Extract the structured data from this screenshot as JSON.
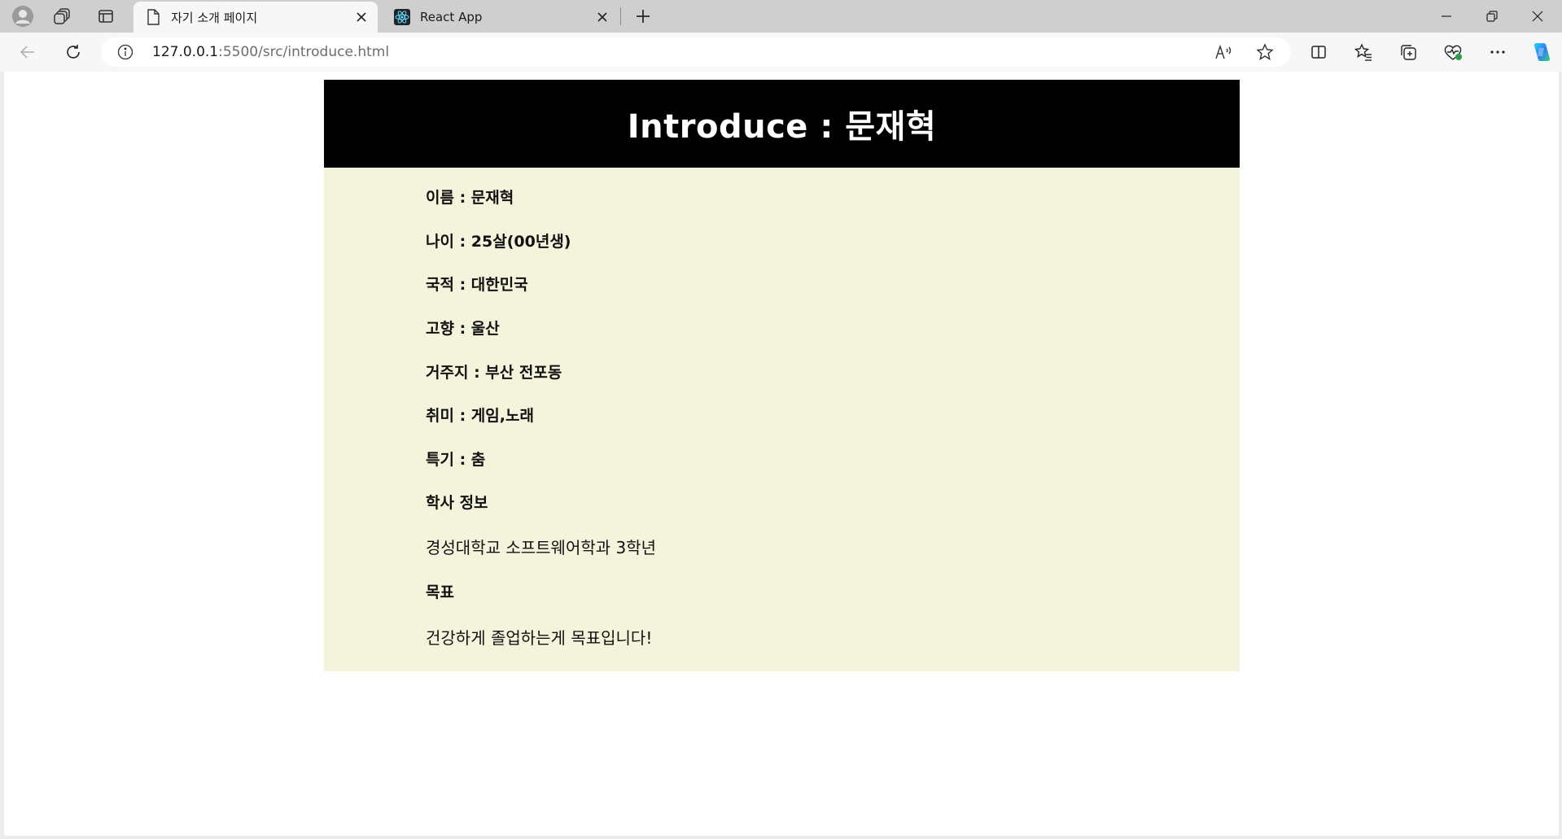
{
  "browser": {
    "tabs": [
      {
        "title": "자기 소개 페이지",
        "active": true
      },
      {
        "title": "React App",
        "active": false
      }
    ],
    "address": {
      "url_host": "127.0.0.1",
      "url_path": ":5500/src/introduce.html"
    },
    "toolbar_icons": [
      "back-icon",
      "refresh-icon",
      "info-icon",
      "read-aloud-icon",
      "favorite-star-icon",
      "split-screen-icon",
      "favorites-icon",
      "collections-icon",
      "browser-essentials-icon",
      "more-icon",
      "copilot-icon"
    ]
  },
  "page": {
    "title": "Introduce : 문재혁",
    "fields": [
      {
        "label": "이름",
        "sep": " : ",
        "value": "문재혁"
      },
      {
        "label": "나이",
        "sep": " : ",
        "value": "25살(00년생)"
      },
      {
        "label": "국적",
        "sep": " : ",
        "value": "대한민국"
      },
      {
        "label": "고향",
        "sep": " : ",
        "value": "울산"
      },
      {
        "label": "거주지",
        "sep": " : ",
        "value": "부산 전포동"
      },
      {
        "label": "취미",
        "sep": " : ",
        "value": "게임,노래"
      },
      {
        "label": "특기",
        "sep": " : ",
        "value": "춤"
      }
    ],
    "academic_heading": "학사 정보",
    "academic_text": "경성대학교 소프트웨어학과 3학년",
    "goal_heading": "목표",
    "goal_text": "건강하게 졸업하는게 목표입니다!"
  },
  "colors": {
    "header_bg": "#000000",
    "body_bg": "#f4f4dc",
    "title_text": "#ffffff"
  }
}
